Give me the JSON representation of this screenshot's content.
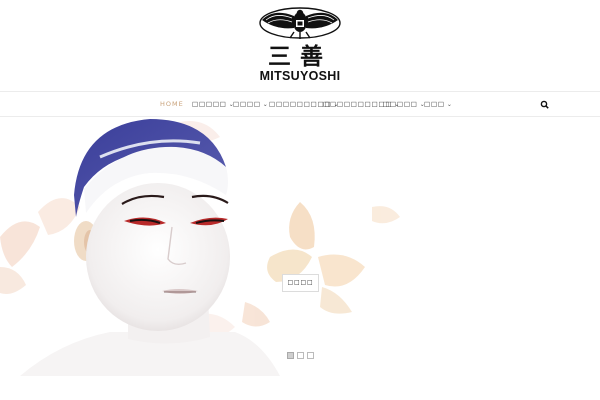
{
  "brand": {
    "kanji": "三善",
    "name": "MITSUYOSHI",
    "logo_icon": "eagle-crest-icon"
  },
  "nav": {
    "items": [
      {
        "label": "HOME",
        "active": true,
        "dropdown": false
      },
      {
        "label": "□□□□□",
        "active": false,
        "dropdown": true
      },
      {
        "label": "□□□□",
        "active": false,
        "dropdown": true
      },
      {
        "label": "□□□□□□□□□",
        "active": false,
        "dropdown": true
      },
      {
        "label": "□□□□□□□□□□",
        "active": false,
        "dropdown": true
      },
      {
        "label": "□□□□□",
        "active": false,
        "dropdown": true
      },
      {
        "label": "□□□",
        "active": false,
        "dropdown": true
      }
    ],
    "search_icon": "search-icon",
    "accent_color": "#c9a27a"
  },
  "hero": {
    "button_label": "□□□□",
    "slide_count": 3,
    "active_slide": 1,
    "image_subject": "kabuki-makeup-portrait"
  }
}
